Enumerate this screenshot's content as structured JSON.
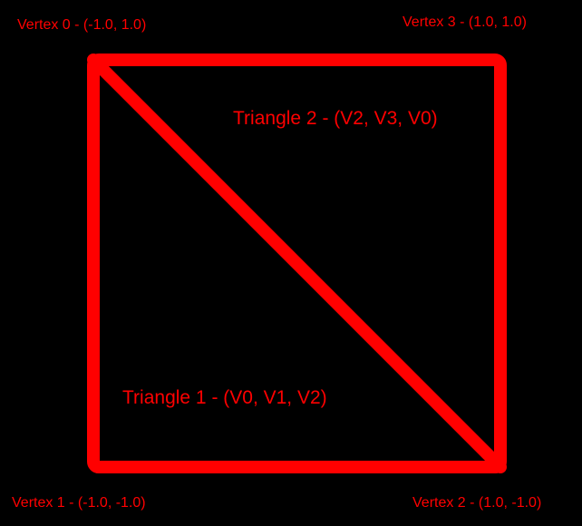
{
  "colors": {
    "background": "#000000",
    "stroke": "#ff0000",
    "text": "#ff0000"
  },
  "vertices": [
    {
      "label": "Vertex 0 - (-1.0, 1.0)",
      "x": -1.0,
      "y": 1.0
    },
    {
      "label": "Vertex 1 - (-1.0, -1.0)",
      "x": -1.0,
      "y": -1.0
    },
    {
      "label": "Vertex 2 - (1.0, -1.0)",
      "x": 1.0,
      "y": -1.0
    },
    {
      "label": "Vertex 3 - (1.0, 1.0)",
      "x": 1.0,
      "y": 1.0
    }
  ],
  "triangles": [
    {
      "label": "Triangle 1 - (V0, V1, V2)",
      "indices": [
        0,
        1,
        2
      ]
    },
    {
      "label": "Triangle 2 - (V2, V3, V0)",
      "indices": [
        2,
        3,
        0
      ]
    }
  ]
}
